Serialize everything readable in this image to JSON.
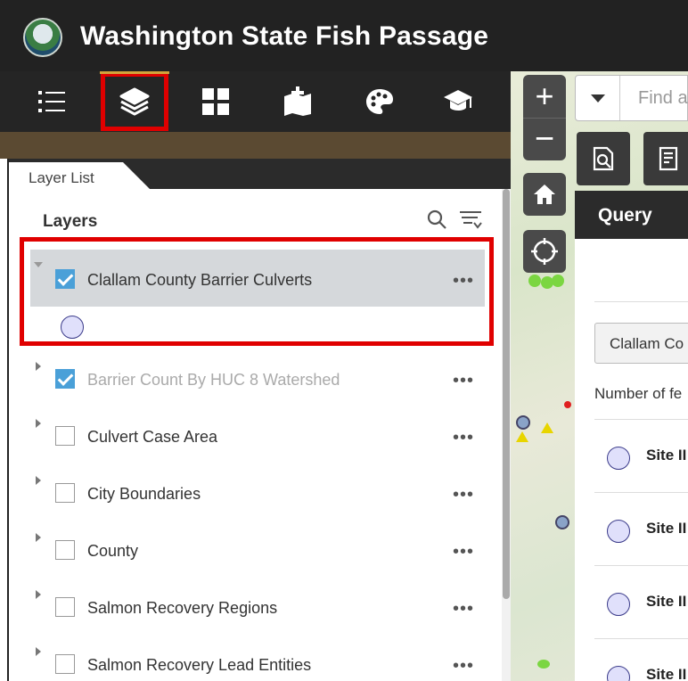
{
  "header": {
    "title": "Washington State Fish Passage"
  },
  "toolbar": {
    "items": [
      {
        "name": "legend"
      },
      {
        "name": "layer-list"
      },
      {
        "name": "basemap-gallery"
      },
      {
        "name": "add-data"
      },
      {
        "name": "print"
      },
      {
        "name": "about"
      }
    ]
  },
  "panel": {
    "tab_label": "Layer List",
    "section_title": "Layers",
    "more_glyph": "•••",
    "layers": [
      {
        "label": "Clallam County Barrier Culverts",
        "checked": true,
        "expanded": true,
        "dim": false
      },
      {
        "label": "Barrier Count By HUC 8 Watershed",
        "checked": true,
        "expanded": false,
        "dim": true
      },
      {
        "label": "Culvert Case Area",
        "checked": false,
        "expanded": false,
        "dim": false
      },
      {
        "label": "City Boundaries",
        "checked": false,
        "expanded": false,
        "dim": false
      },
      {
        "label": "County",
        "checked": false,
        "expanded": false,
        "dim": false
      },
      {
        "label": "Salmon Recovery Regions",
        "checked": false,
        "expanded": false,
        "dim": false
      },
      {
        "label": "Salmon Recovery Lead Entities",
        "checked": false,
        "expanded": false,
        "dim": false
      }
    ]
  },
  "map": {
    "zoom_in": "+",
    "zoom_out": "−",
    "find_placeholder": "Find a"
  },
  "query": {
    "title": "Query",
    "select_value": "Clallam Co",
    "count_label": "Number of fe",
    "items": [
      "Site II",
      "Site II",
      "Site II",
      "Site II"
    ]
  },
  "colors": {
    "accent_red": "#e00000",
    "check_blue": "#4aa0d8",
    "header_bg": "#222222"
  }
}
